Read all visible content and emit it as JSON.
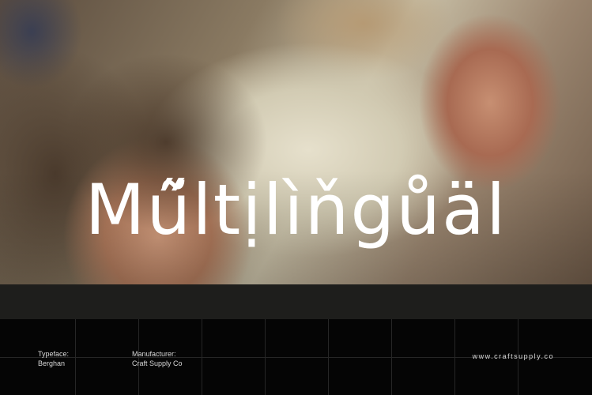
{
  "hero": {
    "title": "Mű̃ltịlìňgůäl",
    "image_alt": "photo of two people lying down"
  },
  "footer": {
    "typeface_label": "Typeface:",
    "typeface_value": "Berghan",
    "manufacturer_label": "Manufacturer:",
    "manufacturer_value": "Craft Supply Co",
    "website": "www.craftsupply.co"
  },
  "colors": {
    "background": "#000000",
    "band": "#1e1e1c",
    "text": "#ffffff"
  }
}
